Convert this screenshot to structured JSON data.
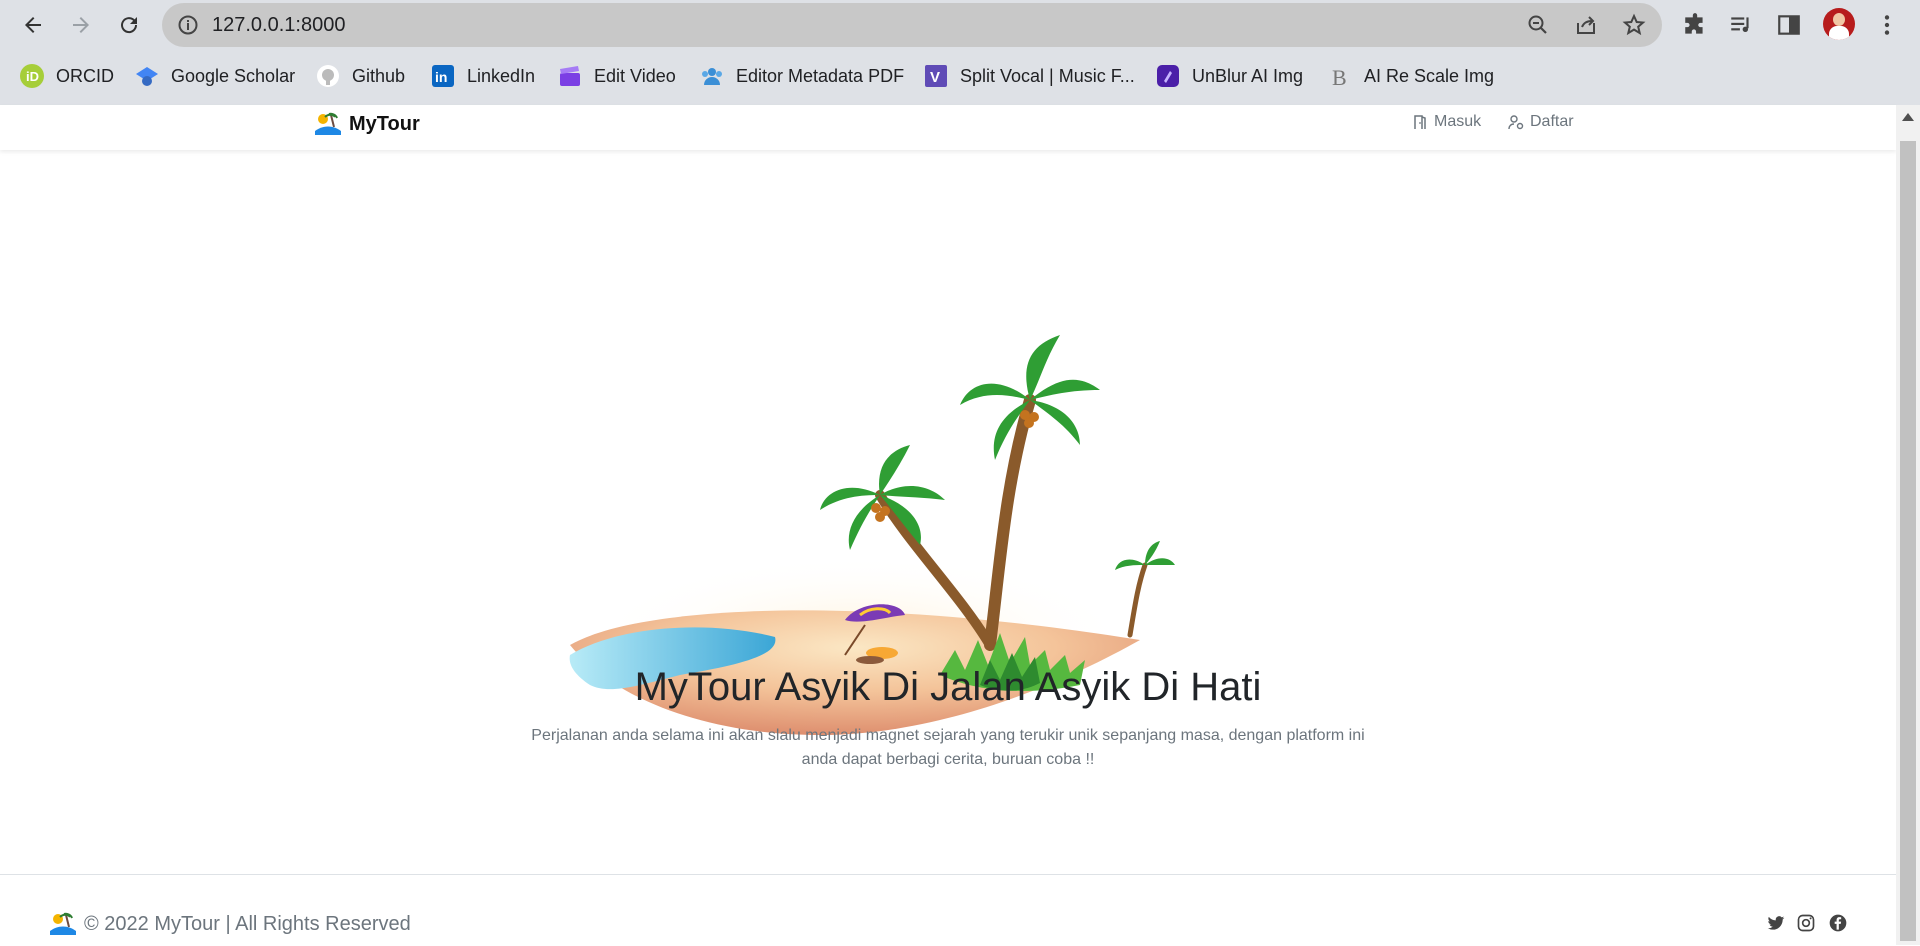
{
  "browser": {
    "url": "127.0.0.1:8000",
    "bookmarks": [
      {
        "label": "ORCID",
        "icon": "orcid-icon"
      },
      {
        "label": "Google Scholar",
        "icon": "scholar-icon"
      },
      {
        "label": "Github",
        "icon": "github-icon"
      },
      {
        "label": "LinkedIn",
        "icon": "linkedin-icon"
      },
      {
        "label": "Edit Video",
        "icon": "clapper-icon"
      },
      {
        "label": "Editor Metadata PDF",
        "icon": "people-icon"
      },
      {
        "label": "Split Vocal | Music F...",
        "icon": "v-icon"
      },
      {
        "label": "UnBlur AI Img",
        "icon": "unblur-icon"
      },
      {
        "label": "AI Re Scale Img",
        "icon": "b-icon"
      }
    ]
  },
  "navbar": {
    "brand": "MyTour",
    "login": "Masuk",
    "register": "Daftar"
  },
  "hero": {
    "title": "MyTour Asyik Di Jalan Asyik Di Hati",
    "subtitle": "Perjalanan anda selama ini akan slalu menjadi magnet sejarah yang terukir unik sepanjang masa, dengan platform ini anda dapat berbagi cerita, buruan coba !!"
  },
  "footer": {
    "copyright": "© 2022 MyTour | All Rights Reserved"
  },
  "colors": {
    "chrome_bg": "#dee1e6",
    "omnibox_bg": "#c8c8c8",
    "text_muted": "#6c757d",
    "title": "#212529"
  }
}
